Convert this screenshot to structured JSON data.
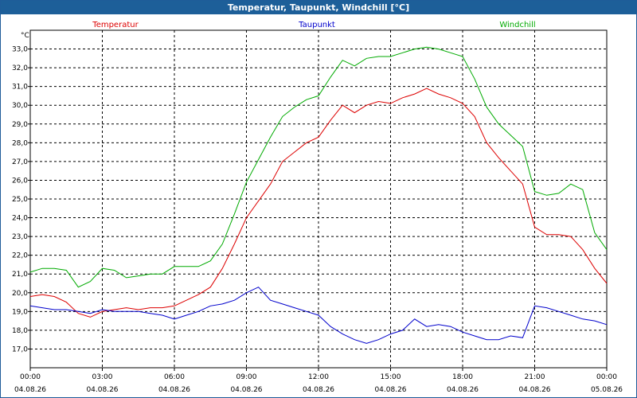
{
  "chart_data": {
    "type": "line",
    "title": "Temperatur, Taupunkt, Windchill [°C]",
    "ylabel": "°C",
    "ylim": [
      16.0,
      34.0
    ],
    "yticks": [
      "17,0",
      "18,0",
      "19,0",
      "20,0",
      "21,0",
      "22,0",
      "23,0",
      "24,0",
      "25,0",
      "26,0",
      "27,0",
      "28,0",
      "29,0",
      "30,0",
      "31,0",
      "32,0",
      "33,0"
    ],
    "xlim": [
      "2026-08-04T00:00",
      "2026-08-05T00:00"
    ],
    "xticks": [
      {
        "time": "00:00",
        "date": "04.08.26"
      },
      {
        "time": "03:00",
        "date": "04.08.26"
      },
      {
        "time": "06:00",
        "date": "04.08.26"
      },
      {
        "time": "09:00",
        "date": "04.08.26"
      },
      {
        "time": "12:00",
        "date": "04.08.26"
      },
      {
        "time": "15:00",
        "date": "04.08.26"
      },
      {
        "time": "18:00",
        "date": "04.08.26"
      },
      {
        "time": "21:00",
        "date": "04.08.26"
      },
      {
        "time": "00:00",
        "date": "05.08.26"
      }
    ],
    "grid": true,
    "x": [
      "00:00",
      "00:30",
      "01:00",
      "01:30",
      "02:00",
      "02:30",
      "03:00",
      "03:30",
      "04:00",
      "04:30",
      "05:00",
      "05:30",
      "06:00",
      "06:30",
      "07:00",
      "07:30",
      "08:00",
      "08:30",
      "09:00",
      "09:30",
      "10:00",
      "10:30",
      "11:00",
      "11:30",
      "12:00",
      "12:30",
      "13:00",
      "13:30",
      "14:00",
      "14:30",
      "15:00",
      "15:30",
      "16:00",
      "16:30",
      "17:00",
      "17:30",
      "18:00",
      "18:30",
      "19:00",
      "19:30",
      "20:00",
      "20:30",
      "21:00",
      "21:30",
      "22:00",
      "22:30",
      "23:00",
      "23:30",
      "24:00"
    ],
    "series": [
      {
        "name": "Temperatur",
        "color": "#dd0000",
        "values": [
          19.8,
          19.9,
          19.8,
          19.5,
          18.9,
          18.7,
          19.0,
          19.1,
          19.2,
          19.1,
          19.2,
          19.2,
          19.3,
          19.6,
          19.9,
          20.3,
          21.3,
          22.6,
          24.0,
          24.9,
          25.8,
          27.0,
          27.5,
          28.0,
          28.3,
          29.2,
          30.0,
          29.6,
          30.0,
          30.2,
          30.1,
          30.4,
          30.6,
          30.9,
          30.6,
          30.4,
          30.1,
          29.4,
          28.0,
          27.2,
          26.5,
          25.8,
          23.5,
          23.1,
          23.1,
          23.0,
          22.3,
          21.3,
          20.5
        ]
      },
      {
        "name": "Taupunkt",
        "color": "#0000cc",
        "values": [
          19.3,
          19.2,
          19.1,
          19.1,
          19.0,
          18.9,
          19.1,
          19.0,
          19.0,
          19.0,
          18.9,
          18.8,
          18.6,
          18.8,
          19.0,
          19.3,
          19.4,
          19.6,
          20.0,
          20.3,
          19.6,
          19.4,
          19.2,
          19.0,
          18.8,
          18.2,
          17.8,
          17.5,
          17.3,
          17.5,
          17.8,
          18.0,
          18.6,
          18.2,
          18.3,
          18.2,
          17.9,
          17.7,
          17.5,
          17.5,
          17.7,
          17.6,
          19.3,
          19.2,
          19.0,
          18.8,
          18.6,
          18.5,
          18.3
        ]
      },
      {
        "name": "Windchill",
        "color": "#00aa00",
        "values": [
          21.1,
          21.3,
          21.3,
          21.2,
          20.3,
          20.6,
          21.3,
          21.2,
          20.8,
          20.9,
          21.0,
          21.0,
          21.4,
          21.4,
          21.4,
          21.7,
          22.6,
          24.2,
          25.9,
          27.1,
          28.3,
          29.4,
          29.9,
          30.3,
          30.5,
          31.5,
          32.4,
          32.1,
          32.5,
          32.6,
          32.6,
          32.8,
          33.0,
          33.1,
          33.0,
          32.8,
          32.6,
          31.4,
          29.9,
          29.0,
          28.4,
          27.8,
          25.4,
          25.2,
          25.3,
          25.8,
          25.5,
          23.2,
          22.3
        ]
      }
    ]
  }
}
